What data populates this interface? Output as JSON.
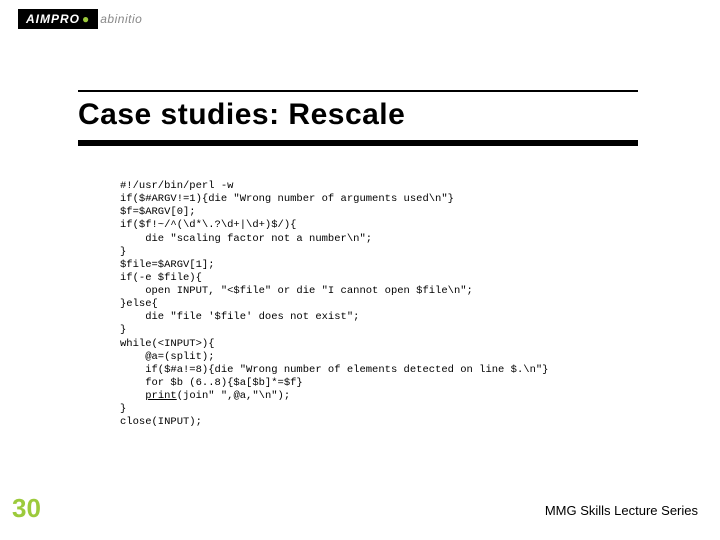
{
  "logo": {
    "main": "AIMPRO",
    "sub": "abinitio"
  },
  "title": "Case studies: Rescale",
  "code": {
    "l1": "#!/usr/bin/perl -w",
    "l2": "if($#ARGV!=1){die \"Wrong number of arguments used\\n\"}",
    "l3": "$f=$ARGV[0];",
    "l4": "if($f!~/^(\\d*\\.?\\d+|\\d+)$/){",
    "l5": "    die \"scaling factor not a number\\n\";",
    "l6": "}",
    "l7": "$file=$ARGV[1];",
    "l8": "if(-e $file){",
    "l9": "    open INPUT, \"<$file\" or die \"I cannot open $file\\n\";",
    "l10": "}else{",
    "l11": "    die \"file '$file' does not exist\";",
    "l12": "}",
    "l13": "while(<INPUT>){",
    "l14": "    @a=(split);",
    "l15": "    if($#a!=8){die \"Wrong number of elements detected on line $.\\n\"}",
    "l16": "    for $b (6..8){$a[$b]*=$f}",
    "l17a": "    ",
    "l17b": "print",
    "l17c": "(join\" \",@a,\"\\n\");",
    "l18": "}",
    "l19": "close(INPUT);"
  },
  "page_number": "30",
  "footer": "MMG Skills Lecture Series"
}
